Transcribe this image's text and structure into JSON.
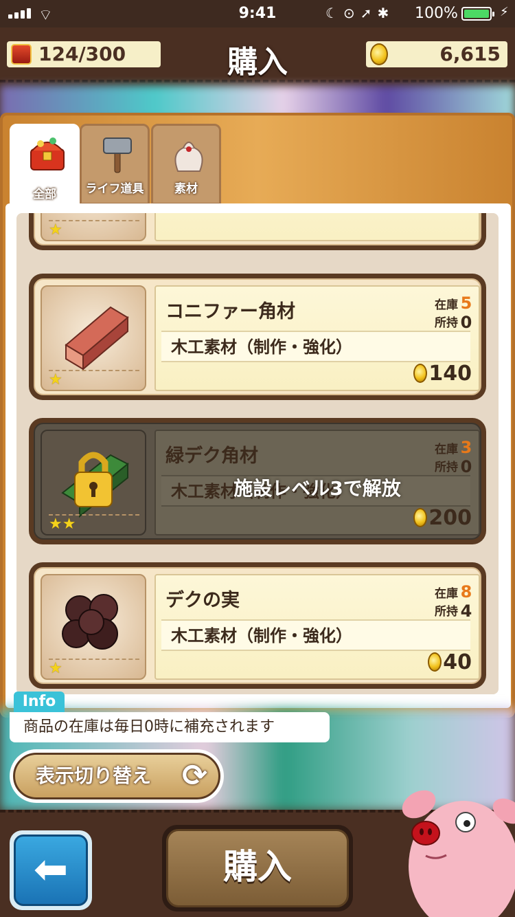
{
  "status_bar": {
    "time": "9:41",
    "battery_percent": "100%",
    "battery_color": "#4cd964"
  },
  "header": {
    "capacity": "124/300",
    "title": "購入",
    "gold": "6,615"
  },
  "tabs": [
    {
      "label": "全部",
      "icon": "treasure-chest-icon",
      "active": true
    },
    {
      "label": "ライフ道具",
      "icon": "hammer-icon",
      "active": false
    },
    {
      "label": "素材",
      "icon": "sack-icon",
      "active": false
    }
  ],
  "items": [
    {
      "name": "コニファー角材",
      "description": "木工素材（制作・強化）",
      "stock_label": "在庫",
      "owned_label": "所持",
      "stock": "5",
      "owned": "0",
      "price": "140",
      "stars": "★",
      "locked": false
    },
    {
      "name": "緑デク角材",
      "description": "木工素材（制作・強化）",
      "stock_label": "在庫",
      "owned_label": "所持",
      "stock": "3",
      "owned": "0",
      "price": "200",
      "stars": "★★",
      "locked": true,
      "lock_message": "施設レベル3で解放"
    },
    {
      "name": "デクの実",
      "description": "木工素材（制作・強化）",
      "stock_label": "在庫",
      "owned_label": "所持",
      "stock": "8",
      "owned": "4",
      "price": "40",
      "stars": "★",
      "locked": false
    }
  ],
  "info": {
    "tag": "Info",
    "text": "商品の在庫は毎日0時に補充されます"
  },
  "toggle_label": "表示切り替え",
  "buy_label": "購入",
  "colors": {
    "accent_stock": "#e8791a",
    "info_tag": "#3ac2d8",
    "back_button": "#1a73b5"
  }
}
